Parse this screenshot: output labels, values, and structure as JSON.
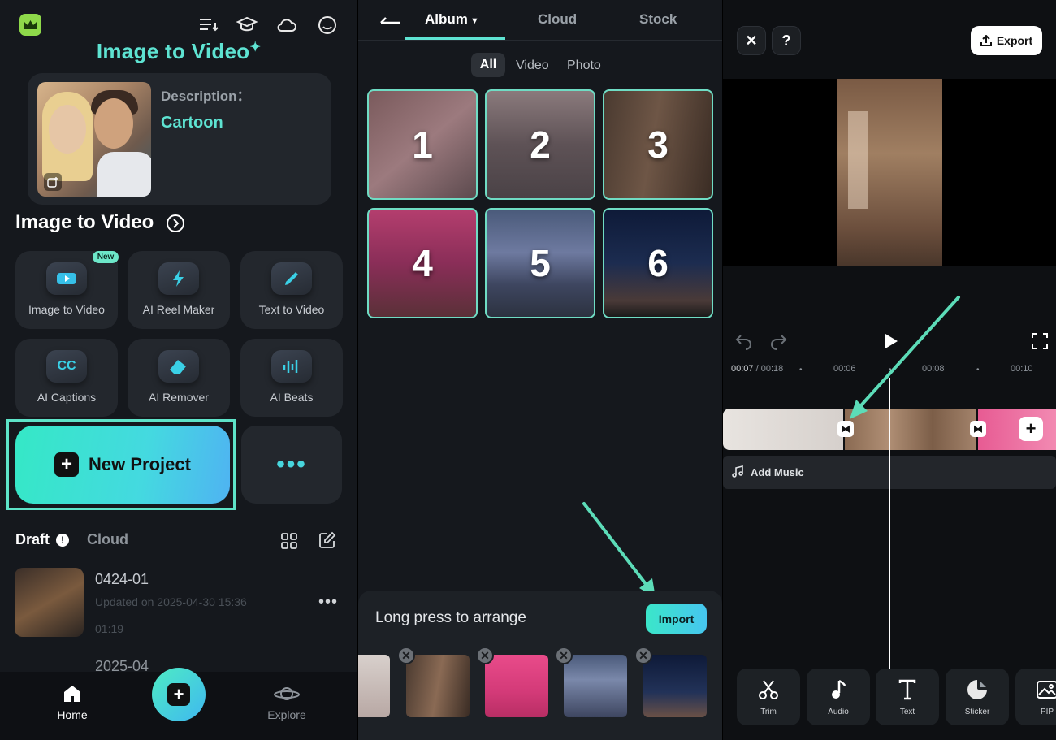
{
  "home": {
    "brand_title": "Image to Video",
    "card": {
      "description_label": "Description：",
      "description_value": "Cartoon"
    },
    "section_title": "Image to Video",
    "tools": [
      {
        "label": "Image to Video",
        "badge": "New"
      },
      {
        "label": "AI Reel Maker"
      },
      {
        "label": "Text to Video"
      },
      {
        "label": "AI Captions",
        "icon_text": "CC"
      },
      {
        "label": "AI Remover"
      },
      {
        "label": "AI Beats"
      }
    ],
    "new_project_label": "New Project",
    "more_label": "•••",
    "tabs": {
      "draft": "Draft",
      "cloud": "Cloud"
    },
    "drafts": [
      {
        "name": "0424-01",
        "updated": "Updated on 2025-04-30 15:36",
        "duration": "01:19",
        "more": "•••"
      },
      {
        "name": "2025-04"
      }
    ],
    "nav": {
      "home": "Home",
      "explore": "Explore"
    }
  },
  "album": {
    "tabs": {
      "album": "Album",
      "cloud": "Cloud",
      "stock": "Stock"
    },
    "filters": {
      "all": "All",
      "video": "Video",
      "photo": "Photo"
    },
    "grid_numbers": [
      "1",
      "2",
      "3",
      "4",
      "5",
      "6"
    ],
    "arrange_text": "Long press to arrange",
    "import_label": "Import"
  },
  "editor": {
    "close": "✕",
    "help": "?",
    "export_label": "Export",
    "time_current": "00:07",
    "time_total": "/ 00:18",
    "ticks": [
      "00:06",
      "00:08",
      "00:10"
    ],
    "add_music": "Add Music",
    "tools": [
      "Trim",
      "Audio",
      "Text",
      "Sticker",
      "PIP"
    ]
  },
  "colors": {
    "accent": "#5ee3d2",
    "highlight_border": "#5ee3c8",
    "arrow": "#5cdcb8"
  }
}
